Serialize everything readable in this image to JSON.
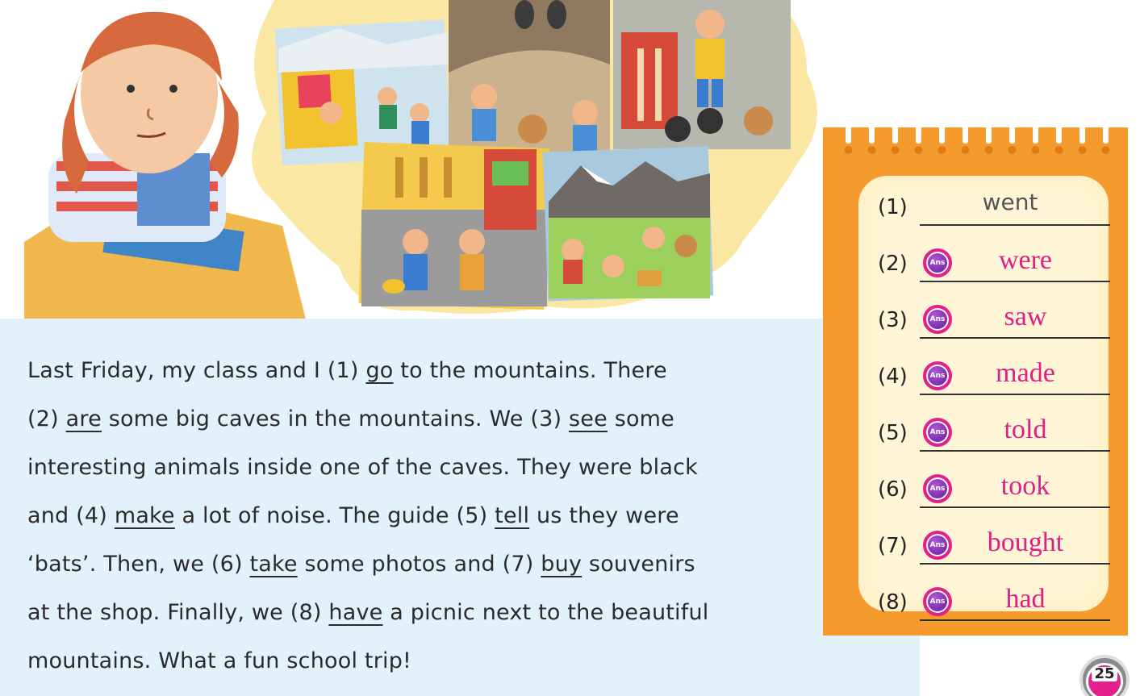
{
  "passage": {
    "lines": [
      [
        "Last Friday, my class and I (1) ",
        {
          "u": "go"
        },
        " to the mountains. There"
      ],
      [
        "(2) ",
        {
          "u": "are"
        },
        " some big caves in the mountains. We (3) ",
        {
          "u": "see"
        },
        " some"
      ],
      [
        "interesting animals inside one of the caves. They were black"
      ],
      [
        "and (4) ",
        {
          "u": "make"
        },
        " a lot of noise. The guide (5) ",
        {
          "u": "tell"
        },
        " us they were"
      ],
      [
        "‘bats’. Then, we (6) ",
        {
          "u": "take"
        },
        " some photos and (7) ",
        {
          "u": "buy"
        },
        " souvenirs"
      ],
      [
        "at the shop. Finally, we (8) ",
        {
          "u": "have"
        },
        " a picnic next to the beautiful"
      ],
      [
        "mountains. What a fun school trip!"
      ]
    ]
  },
  "answers": [
    {
      "num": "(1)",
      "text": "went",
      "has_icon": false
    },
    {
      "num": "(2)",
      "text": "were",
      "has_icon": true
    },
    {
      "num": "(3)",
      "text": "saw",
      "has_icon": true
    },
    {
      "num": "(4)",
      "text": "made",
      "has_icon": true
    },
    {
      "num": "(5)",
      "text": "told",
      "has_icon": true
    },
    {
      "num": "(6)",
      "text": "took",
      "has_icon": true
    },
    {
      "num": "(7)",
      "text": "bought",
      "has_icon": true
    },
    {
      "num": "(8)",
      "text": "had",
      "has_icon": true
    }
  ],
  "ans_icon_label": "Ans",
  "page_number": "25",
  "colors": {
    "answer_pink": "#e01f86",
    "notepad_orange": "#f59a2c",
    "passage_bg": "#e2f1fa",
    "ans_icon_purple": "#7d2fb0"
  }
}
